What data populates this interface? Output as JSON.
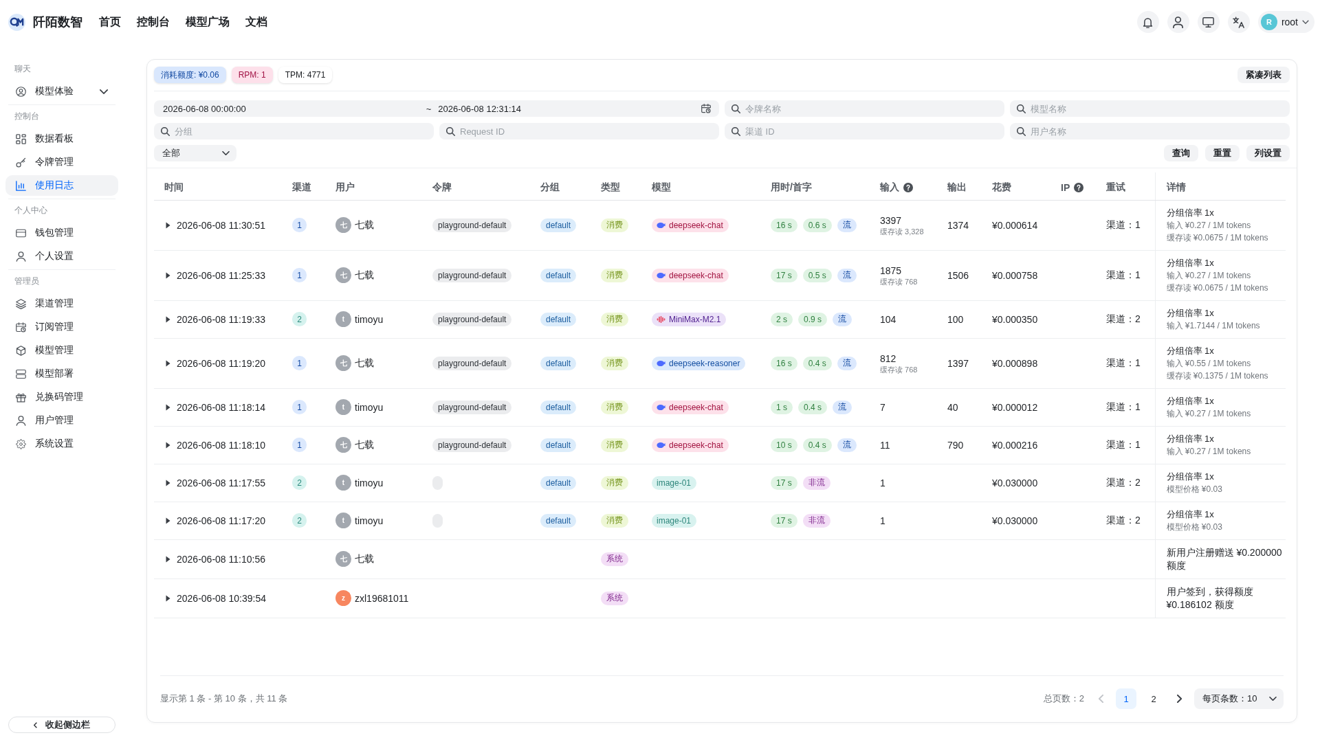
{
  "header": {
    "brand": "阡陌数智",
    "nav": [
      "首页",
      "控制台",
      "模型广场",
      "文档"
    ],
    "user": {
      "avatar": "R",
      "name": "root"
    }
  },
  "sidebar": {
    "sections": [
      {
        "title": "聊天",
        "items": [
          {
            "label": "模型体验",
            "kind": "group",
            "selected": false
          }
        ]
      },
      {
        "title": "控制台",
        "items": [
          {
            "label": "数据看板",
            "kind": "link",
            "selected": false
          },
          {
            "label": "令牌管理",
            "kind": "link",
            "selected": false
          },
          {
            "label": "使用日志",
            "kind": "link",
            "selected": true
          }
        ]
      },
      {
        "title": "个人中心",
        "items": [
          {
            "label": "钱包管理",
            "kind": "link",
            "selected": false
          },
          {
            "label": "个人设置",
            "kind": "link",
            "selected": false
          }
        ]
      },
      {
        "title": "管理员",
        "items": [
          {
            "label": "渠道管理",
            "kind": "link",
            "selected": false
          },
          {
            "label": "订阅管理",
            "kind": "link",
            "selected": false
          },
          {
            "label": "模型管理",
            "kind": "link",
            "selected": false
          },
          {
            "label": "模型部署",
            "kind": "link",
            "selected": false
          },
          {
            "label": "兑换码管理",
            "kind": "link",
            "selected": false
          },
          {
            "label": "用户管理",
            "kind": "link",
            "selected": false
          },
          {
            "label": "系统设置",
            "kind": "link",
            "selected": false
          }
        ]
      }
    ],
    "collapse_button": "收起侧边栏"
  },
  "stats": [
    {
      "text": "消耗额度: ¥0.06",
      "color": "#d9e7fd"
    },
    {
      "text": "RPM: 1",
      "color": "#fde0ea"
    },
    {
      "text": "TPM: 4771",
      "color": "#ffffff"
    }
  ],
  "compact_button": "紧凑列表",
  "filters": {
    "start": "2026-06-08 00:00:00",
    "separator": "~",
    "end": "2026-06-08 12:31:14",
    "fields": [
      {
        "placeholder": "令牌名称"
      },
      {
        "placeholder": "模型名称"
      },
      {
        "placeholder": "分组"
      },
      {
        "placeholder": "Request ID"
      },
      {
        "placeholder": "渠道 ID"
      },
      {
        "placeholder": "用户名称"
      }
    ],
    "type_select": "全部",
    "buttons": [
      "查询",
      "重置",
      "列设置"
    ]
  },
  "table": {
    "columns": [
      {
        "label": "时间",
        "help": false
      },
      {
        "label": "渠道",
        "help": false
      },
      {
        "label": "用户",
        "help": false
      },
      {
        "label": "令牌",
        "help": false
      },
      {
        "label": "分组",
        "help": false
      },
      {
        "label": "类型",
        "help": false
      },
      {
        "label": "模型",
        "help": false
      },
      {
        "label": "用时/首字",
        "help": false
      },
      {
        "label": "输入",
        "help": true
      },
      {
        "label": "输出",
        "help": false
      },
      {
        "label": "花费",
        "help": false
      },
      {
        "label": "IP",
        "help": true
      },
      {
        "label": "重试",
        "help": false
      },
      {
        "label": "详情",
        "help": false
      }
    ],
    "rows": [
      {
        "expanded": false,
        "time": "2026-06-08 11:30:51",
        "channel": {
          "text": "1",
          "color": "#dbe8fd"
        },
        "user": {
          "avatar": "七",
          "color": "#a3a8af",
          "name": "七载"
        },
        "token": {
          "kind": "tag",
          "text": "playground-default"
        },
        "group": "default",
        "type": {
          "text": "消费",
          "color": "#eef7d6"
        },
        "model": {
          "kind": "fish",
          "text": "deepseek-chat",
          "color": "#fde1ea"
        },
        "timing": [
          {
            "text": "16 s",
            "color": "#dff3e3"
          },
          {
            "text": "0.6 s",
            "color": "#dff3e3"
          },
          {
            "text": "流",
            "color": "#dbe8fd"
          }
        ],
        "input": {
          "value": "3397",
          "cache": "缓存读 3,328"
        },
        "output": "1374",
        "cost": "¥0.000614",
        "retry": "渠道：1",
        "details": [
          {
            "kind": "title",
            "text": "分组倍率 1x"
          },
          {
            "kind": "sub",
            "text": "输入 ¥0.27 / 1M tokens"
          },
          {
            "kind": "sub",
            "text": "缓存读 ¥0.0675 / 1M tokens"
          }
        ]
      },
      {
        "expanded": false,
        "time": "2026-06-08 11:25:33",
        "channel": {
          "text": "1",
          "color": "#dbe8fd"
        },
        "user": {
          "avatar": "七",
          "color": "#a3a8af",
          "name": "七载"
        },
        "token": {
          "kind": "tag",
          "text": "playground-default"
        },
        "group": "default",
        "type": {
          "text": "消费",
          "color": "#eef7d6"
        },
        "model": {
          "kind": "fish",
          "text": "deepseek-chat",
          "color": "#fde1ea"
        },
        "timing": [
          {
            "text": "17 s",
            "color": "#dff3e3"
          },
          {
            "text": "0.5 s",
            "color": "#dff3e3"
          },
          {
            "text": "流",
            "color": "#dbe8fd"
          }
        ],
        "input": {
          "value": "1875",
          "cache": "缓存读 768"
        },
        "output": "1506",
        "cost": "¥0.000758",
        "retry": "渠道：1",
        "details": [
          {
            "kind": "title",
            "text": "分组倍率 1x"
          },
          {
            "kind": "sub",
            "text": "输入 ¥0.27 / 1M tokens"
          },
          {
            "kind": "sub",
            "text": "缓存读 ¥0.0675 / 1M tokens"
          }
        ]
      },
      {
        "expanded": false,
        "time": "2026-06-08 11:19:33",
        "channel": {
          "text": "2",
          "color": "#d5f2ee"
        },
        "user": {
          "avatar": "t",
          "color": "#a3a8af",
          "name": "timoyu"
        },
        "token": {
          "kind": "tag",
          "text": "playground-default"
        },
        "group": "default",
        "type": {
          "text": "消费",
          "color": "#eef7d6"
        },
        "model": {
          "kind": "wave",
          "text": "MiniMax-M2.1",
          "color": "#ebe1f8"
        },
        "timing": [
          {
            "text": "2 s",
            "color": "#dff3e3"
          },
          {
            "text": "0.9 s",
            "color": "#dff3e3"
          },
          {
            "text": "流",
            "color": "#dbe8fd"
          }
        ],
        "input": {
          "value": "104"
        },
        "output": "100",
        "cost": "¥0.000350",
        "retry": "渠道：2",
        "details": [
          {
            "kind": "title",
            "text": "分组倍率 1x"
          },
          {
            "kind": "sub",
            "text": "输入 ¥1.7144 / 1M tokens"
          }
        ]
      },
      {
        "expanded": false,
        "time": "2026-06-08 11:19:20",
        "channel": {
          "text": "1",
          "color": "#dbe8fd"
        },
        "user": {
          "avatar": "七",
          "color": "#a3a8af",
          "name": "七载"
        },
        "token": {
          "kind": "tag",
          "text": "playground-default"
        },
        "group": "default",
        "type": {
          "text": "消费",
          "color": "#eef7d6"
        },
        "model": {
          "kind": "fish",
          "text": "deepseek-reasoner",
          "color": "#dbe9fc"
        },
        "timing": [
          {
            "text": "16 s",
            "color": "#dff3e3"
          },
          {
            "text": "0.4 s",
            "color": "#dff3e3"
          },
          {
            "text": "流",
            "color": "#dbe8fd"
          }
        ],
        "input": {
          "value": "812",
          "cache": "缓存读 768"
        },
        "output": "1397",
        "cost": "¥0.000898",
        "retry": "渠道：1",
        "details": [
          {
            "kind": "title",
            "text": "分组倍率 1x"
          },
          {
            "kind": "sub",
            "text": "输入 ¥0.55 / 1M tokens"
          },
          {
            "kind": "sub",
            "text": "缓存读 ¥0.1375 / 1M tokens"
          }
        ]
      },
      {
        "expanded": false,
        "time": "2026-06-08 11:18:14",
        "channel": {
          "text": "1",
          "color": "#dbe8fd"
        },
        "user": {
          "avatar": "t",
          "color": "#a3a8af",
          "name": "timoyu"
        },
        "token": {
          "kind": "tag",
          "text": "playground-default"
        },
        "group": "default",
        "type": {
          "text": "消费",
          "color": "#eef7d6"
        },
        "model": {
          "kind": "fish",
          "text": "deepseek-chat",
          "color": "#fde1ea"
        },
        "timing": [
          {
            "text": "1 s",
            "color": "#dff3e3"
          },
          {
            "text": "0.4 s",
            "color": "#dff3e3"
          },
          {
            "text": "流",
            "color": "#dbe8fd"
          }
        ],
        "input": {
          "value": "7"
        },
        "output": "40",
        "cost": "¥0.000012",
        "retry": "渠道：1",
        "details": [
          {
            "kind": "title",
            "text": "分组倍率 1x"
          },
          {
            "kind": "sub",
            "text": "输入 ¥0.27 / 1M tokens"
          }
        ]
      },
      {
        "expanded": false,
        "time": "2026-06-08 11:18:10",
        "channel": {
          "text": "1",
          "color": "#dbe8fd"
        },
        "user": {
          "avatar": "七",
          "color": "#a3a8af",
          "name": "七载"
        },
        "token": {
          "kind": "tag",
          "text": "playground-default"
        },
        "group": "default",
        "type": {
          "text": "消费",
          "color": "#eef7d6"
        },
        "model": {
          "kind": "fish",
          "text": "deepseek-chat",
          "color": "#fde1ea"
        },
        "timing": [
          {
            "text": "10 s",
            "color": "#dff3e3"
          },
          {
            "text": "0.4 s",
            "color": "#dff3e3"
          },
          {
            "text": "流",
            "color": "#dbe8fd"
          }
        ],
        "input": {
          "value": "11"
        },
        "output": "790",
        "cost": "¥0.000216",
        "retry": "渠道：1",
        "details": [
          {
            "kind": "title",
            "text": "分组倍率 1x"
          },
          {
            "kind": "sub",
            "text": "输入 ¥0.27 / 1M tokens"
          }
        ]
      },
      {
        "expanded": false,
        "time": "2026-06-08 11:17:55",
        "channel": {
          "text": "2",
          "color": "#d5f2ee"
        },
        "user": {
          "avatar": "t",
          "color": "#a3a8af",
          "name": "timoyu"
        },
        "token": {
          "kind": "blank"
        },
        "group": "default",
        "type": {
          "text": "消费",
          "color": "#eef7d6"
        },
        "model": {
          "kind": "plain",
          "text": "image-01",
          "color": "#d8f2ef"
        },
        "timing": [
          {
            "text": "17 s",
            "color": "#dff3e3"
          },
          {
            "text": "非流",
            "color": "#f3def6"
          }
        ],
        "input": {
          "value": "1"
        },
        "cost": "¥0.030000",
        "retry": "渠道：2",
        "details": [
          {
            "kind": "title",
            "text": "分组倍率 1x"
          },
          {
            "kind": "sub",
            "text": "模型价格 ¥0.03"
          }
        ]
      },
      {
        "expanded": false,
        "time": "2026-06-08 11:17:20",
        "channel": {
          "text": "2",
          "color": "#d5f2ee"
        },
        "user": {
          "avatar": "t",
          "color": "#a3a8af",
          "name": "timoyu"
        },
        "token": {
          "kind": "blank"
        },
        "group": "default",
        "type": {
          "text": "消费",
          "color": "#eef7d6"
        },
        "model": {
          "kind": "plain",
          "text": "image-01",
          "color": "#d8f2ef"
        },
        "timing": [
          {
            "text": "17 s",
            "color": "#dff3e3"
          },
          {
            "text": "非流",
            "color": "#f3def6"
          }
        ],
        "input": {
          "value": "1"
        },
        "cost": "¥0.030000",
        "retry": "渠道：2",
        "details": [
          {
            "kind": "title",
            "text": "分组倍率 1x"
          },
          {
            "kind": "sub",
            "text": "模型价格 ¥0.03"
          }
        ]
      },
      {
        "expanded": false,
        "time": "2026-06-08 11:10:56",
        "user": {
          "avatar": "七",
          "color": "#a3a8af",
          "name": "七载"
        },
        "type": {
          "text": "系统",
          "color": "#f3def6"
        },
        "details": [
          {
            "kind": "note",
            "text": "新用户注册赠送 ¥0.200000 额度"
          }
        ]
      },
      {
        "expanded": false,
        "time": "2026-06-08 10:39:54",
        "user": {
          "avatar": "z",
          "color": "#f7865f",
          "name": "zxl19681011"
        },
        "type": {
          "text": "系统",
          "color": "#f3def6"
        },
        "details": [
          {
            "kind": "note",
            "text": "用户签到，获得额度 ¥0.186102 额度"
          }
        ]
      }
    ]
  },
  "pagination": {
    "summary": "显示第 1 条 - 第 10 条，共 11 条",
    "total": "总页数：2",
    "prev_disabled": true,
    "next_disabled": false,
    "pages": [
      {
        "label": "1",
        "selected": true
      },
      {
        "label": "2",
        "selected": false
      }
    ],
    "page_size": "每页条数：10"
  }
}
